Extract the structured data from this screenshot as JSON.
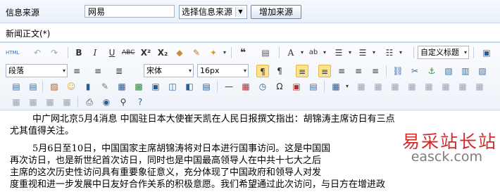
{
  "form": {
    "source_label": "信息来源",
    "source_value": "网易",
    "source_select": "选择信息来源",
    "add_source_button": "增加来源",
    "body_label": "新闻正文(*)"
  },
  "toolbar": {
    "row1": [
      "html-source-icon",
      "undo-icon",
      "redo-icon",
      "bold-icon",
      "italic-icon",
      "underline-icon",
      "strikethrough-icon",
      "superscript-icon",
      "subscript-icon",
      "eraser-icon",
      "format-painter-icon",
      "auto-format-icon",
      "blockquote-icon",
      "paste-text-icon",
      "font-color-icon",
      "highlight-icon",
      "ordered-list-icon",
      "unordered-list-icon",
      "fullscreen-icon"
    ],
    "custom_title": "自定义标题",
    "paragraph": "段落",
    "font_family": "宋体",
    "font_size": "16px"
  },
  "content": {
    "para1": "中广网北京5月4消息 中国驻日本大使崔天凯在人民日报撰文指出：胡锦涛主席访日有三点",
    "para1_cont": "尤其值得关注。",
    "para2_l1": "5月6日至10日，中国国家主席胡锦涛将对日本进行国事访问。这是中国国",
    "para2_l2": "再次访日，也是新世纪首次访日，同时也是中国最高领导人在中共十七大之后",
    "para2_l3": "主席的这次历史性访问具有重要象征意义，充分体现了中国政府和领导人对发",
    "para2_l4": "度重视和进一步发展中日友好合作关系的积极意愿。我们希望通过此次访问，与日方在增进政"
  },
  "watermark": {
    "site_name": "易采站长站",
    "url": "easck.com"
  },
  "colors": {
    "watermark_red": "#d12d2d",
    "selected_bg": "#fde38f"
  }
}
